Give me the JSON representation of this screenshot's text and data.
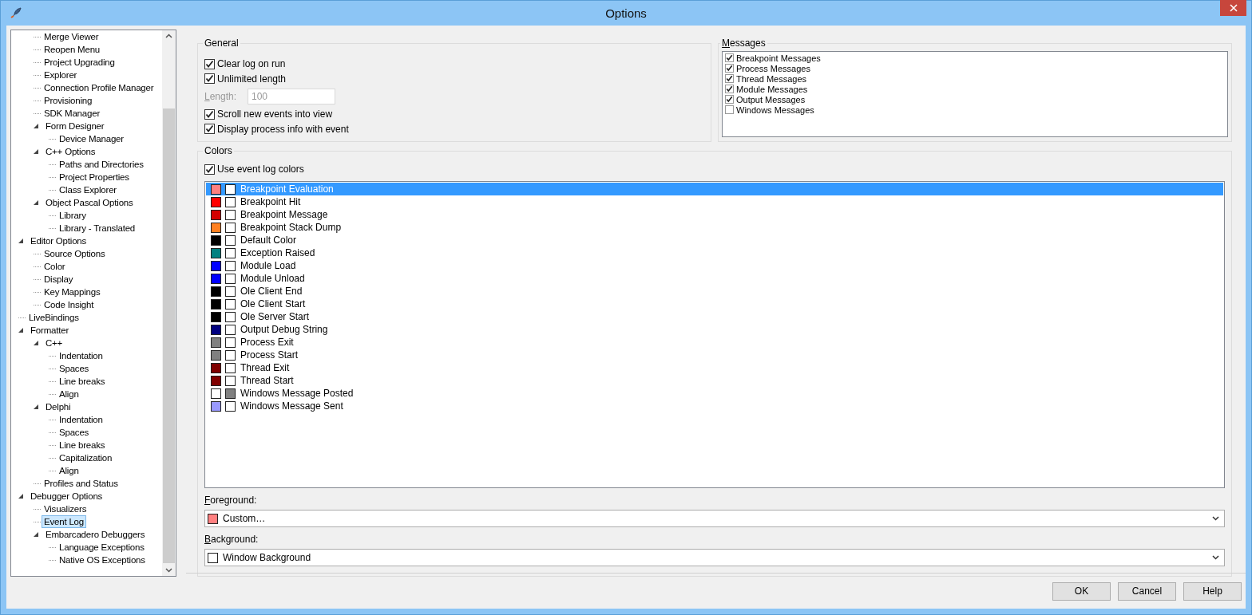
{
  "window": {
    "title": "Options"
  },
  "tree": {
    "scrolled_children": [
      {
        "label": "Merge Viewer",
        "selected": false
      },
      {
        "label": "Reopen Menu",
        "selected": false
      },
      {
        "label": "Project Upgrading",
        "selected": false
      },
      {
        "label": "Explorer",
        "selected": false
      },
      {
        "label": "Connection Profile Manager",
        "selected": false
      },
      {
        "label": "Provisioning",
        "selected": false
      },
      {
        "label": "SDK Manager",
        "selected": false
      },
      {
        "label": "Form Designer",
        "selected": false,
        "expanded": true,
        "children": [
          {
            "label": "Device Manager",
            "selected": false
          }
        ]
      },
      {
        "label": "C++ Options",
        "selected": false,
        "expanded": true,
        "children": [
          {
            "label": "Paths and Directories",
            "selected": false
          },
          {
            "label": "Project Properties",
            "selected": false
          },
          {
            "label": "Class Explorer",
            "selected": false
          }
        ]
      },
      {
        "label": "Object Pascal Options",
        "selected": false,
        "expanded": true,
        "children": [
          {
            "label": "Library",
            "selected": false
          },
          {
            "label": "Library - Translated",
            "selected": false
          }
        ]
      }
    ],
    "items": [
      {
        "label": "Editor Options",
        "selected": false,
        "expanded": true,
        "children": [
          {
            "label": "Source Options",
            "selected": false
          },
          {
            "label": "Color",
            "selected": false
          },
          {
            "label": "Display",
            "selected": false
          },
          {
            "label": "Key Mappings",
            "selected": false
          },
          {
            "label": "Code Insight",
            "selected": false
          }
        ]
      },
      {
        "label": "LiveBindings",
        "selected": false
      },
      {
        "label": "Formatter",
        "selected": false,
        "expanded": true,
        "children": [
          {
            "label": "C++",
            "selected": false,
            "expanded": true,
            "children": [
              {
                "label": "Indentation",
                "selected": false
              },
              {
                "label": "Spaces",
                "selected": false
              },
              {
                "label": "Line breaks",
                "selected": false
              },
              {
                "label": "Align",
                "selected": false
              }
            ]
          },
          {
            "label": "Delphi",
            "selected": false,
            "expanded": true,
            "children": [
              {
                "label": "Indentation",
                "selected": false
              },
              {
                "label": "Spaces",
                "selected": false
              },
              {
                "label": "Line breaks",
                "selected": false
              },
              {
                "label": "Capitalization",
                "selected": false
              },
              {
                "label": "Align",
                "selected": false
              }
            ]
          },
          {
            "label": "Profiles and Status",
            "selected": false
          }
        ]
      },
      {
        "label": "Debugger Options",
        "selected": false,
        "expanded": true,
        "children": [
          {
            "label": "Visualizers",
            "selected": false
          },
          {
            "label": "Event Log",
            "selected": true
          },
          {
            "label": "Embarcadero Debuggers",
            "selected": false,
            "expanded": true,
            "children": [
              {
                "label": "Language Exceptions",
                "selected": false
              },
              {
                "label": "Native OS Exceptions",
                "selected": false
              }
            ]
          }
        ]
      }
    ]
  },
  "general": {
    "title": "General",
    "options": [
      {
        "kind": "checkbox",
        "label": "Clear log on run",
        "checked": true
      },
      {
        "kind": "checkbox",
        "label": "Unlimited length",
        "checked": true
      },
      {
        "kind": "field",
        "label": "Length:",
        "value": "100",
        "disabled": true
      },
      {
        "kind": "checkbox",
        "label": "Scroll new events into view",
        "checked": true
      },
      {
        "kind": "checkbox",
        "label": "Display process info with event",
        "checked": true
      }
    ]
  },
  "messages": {
    "title": "Messages",
    "items": [
      {
        "label": "Breakpoint Messages",
        "checked": true
      },
      {
        "label": "Process Messages",
        "checked": true
      },
      {
        "label": "Thread Messages",
        "checked": true
      },
      {
        "label": "Module Messages",
        "checked": true
      },
      {
        "label": "Output Messages",
        "checked": true
      },
      {
        "label": "Windows Messages",
        "checked": false
      }
    ]
  },
  "colors": {
    "title": "Colors",
    "use_colors": {
      "label": "Use event log colors",
      "checked": true
    },
    "events": [
      {
        "label": "Breakpoint Evaluation",
        "swatches": [
          {
            "color": "#ff8080"
          },
          {
            "color": "#ffffff"
          }
        ],
        "selected": true
      },
      {
        "label": "Breakpoint Hit",
        "swatches": [
          {
            "color": "#ff0000"
          },
          {
            "color": "#ffffff"
          }
        ],
        "selected": false
      },
      {
        "label": "Breakpoint Message",
        "swatches": [
          {
            "color": "#d40000"
          },
          {
            "color": "#ffffff"
          }
        ],
        "selected": false
      },
      {
        "label": "Breakpoint Stack Dump",
        "swatches": [
          {
            "color": "#ff8020"
          },
          {
            "color": "#ffffff"
          }
        ],
        "selected": false
      },
      {
        "label": "Default Color",
        "swatches": [
          {
            "color": "#000000"
          },
          {
            "color": "#ffffff"
          }
        ],
        "selected": false
      },
      {
        "label": "Exception Raised",
        "swatches": [
          {
            "color": "#008080"
          },
          {
            "color": "#ffffff"
          }
        ],
        "selected": false
      },
      {
        "label": "Module Load",
        "swatches": [
          {
            "color": "#0000ff"
          },
          {
            "color": "#ffffff"
          }
        ],
        "selected": false
      },
      {
        "label": "Module Unload",
        "swatches": [
          {
            "color": "#0000ff"
          },
          {
            "color": "#ffffff"
          }
        ],
        "selected": false
      },
      {
        "label": "Ole Client End",
        "swatches": [
          {
            "color": "#000000"
          },
          {
            "color": "#ffffff"
          }
        ],
        "selected": false
      },
      {
        "label": "Ole Client Start",
        "swatches": [
          {
            "color": "#000000"
          },
          {
            "color": "#ffffff"
          }
        ],
        "selected": false
      },
      {
        "label": "Ole Server Start",
        "swatches": [
          {
            "color": "#000000"
          },
          {
            "color": "#ffffff"
          }
        ],
        "selected": false
      },
      {
        "label": "Output Debug String",
        "swatches": [
          {
            "color": "#000080"
          },
          {
            "color": "#ffffff"
          }
        ],
        "selected": false
      },
      {
        "label": "Process Exit",
        "swatches": [
          {
            "color": "#808080"
          },
          {
            "color": "#ffffff"
          }
        ],
        "selected": false
      },
      {
        "label": "Process Start",
        "swatches": [
          {
            "color": "#808080"
          },
          {
            "color": "#ffffff"
          }
        ],
        "selected": false
      },
      {
        "label": "Thread Exit",
        "swatches": [
          {
            "color": "#800000"
          },
          {
            "color": "#ffffff"
          }
        ],
        "selected": false
      },
      {
        "label": "Thread Start",
        "swatches": [
          {
            "color": "#800000"
          },
          {
            "color": "#ffffff"
          }
        ],
        "selected": false
      },
      {
        "label": "Windows Message Posted",
        "swatches": [
          {
            "color": "#ffffff"
          },
          {
            "color": "#808080"
          }
        ],
        "selected": false
      },
      {
        "label": "Windows Message Sent",
        "swatches": [
          {
            "color": "#9999ff"
          },
          {
            "color": "#ffffff"
          }
        ],
        "selected": false
      }
    ],
    "foreground": {
      "label": "Foreground:",
      "value": "Custom…",
      "color": "#ff8080"
    },
    "background": {
      "label": "Background:",
      "value": "Window Background",
      "color": "#ffffff"
    }
  },
  "buttons": [
    "OK",
    "Cancel",
    "Help"
  ]
}
